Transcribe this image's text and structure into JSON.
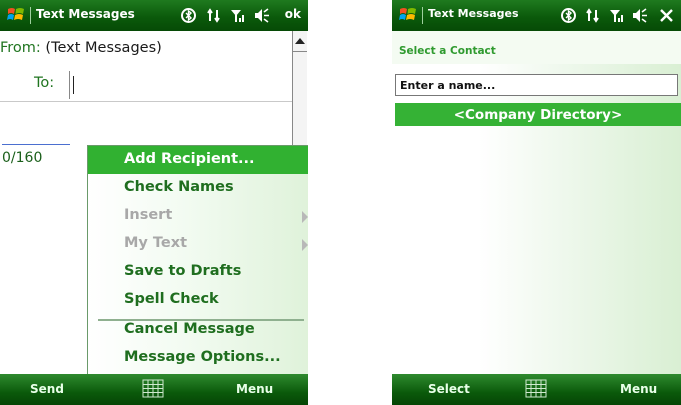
{
  "left_screen": {
    "title": "Text Messages",
    "ok_label": "ok",
    "from_label": "From:",
    "from_value": "(Text Messages)",
    "to_label": "To:",
    "to_value": "",
    "char_counter": "0/160",
    "menu": {
      "items": [
        {
          "label": "Add Recipient...",
          "state": "selected"
        },
        {
          "label": "Check Names",
          "state": "enabled"
        },
        {
          "label": "Insert",
          "state": "disabled",
          "submenu": true
        },
        {
          "label": "My Text",
          "state": "disabled",
          "submenu": true
        },
        {
          "label": "Save to Drafts",
          "state": "enabled"
        },
        {
          "label": "Spell Check",
          "state": "enabled"
        },
        {
          "label": "Cancel Message",
          "state": "enabled"
        },
        {
          "label": "Message Options...",
          "state": "enabled"
        }
      ]
    },
    "softkeys": {
      "left": "Send",
      "right": "Menu"
    }
  },
  "right_screen": {
    "title": "Text Messages",
    "header_label": "Select a Contact",
    "name_input_value": "Enter a name...",
    "list_items": [
      "<Company Directory>"
    ],
    "softkeys": {
      "left": "Select",
      "right": "Menu"
    }
  },
  "colors": {
    "titlebar_green": "#0b5a0b",
    "highlight_green": "#31b131",
    "menu_text_green": "#1f6e1f",
    "disabled_gray": "#a8a8a8"
  },
  "icons": [
    "windows-logo-icon",
    "bluetooth-icon",
    "connectivity-icon",
    "signal-icon",
    "volume-icon",
    "keyboard-icon",
    "close-icon",
    "scroll-up-arrow-icon",
    "submenu-arrow-icon"
  ]
}
